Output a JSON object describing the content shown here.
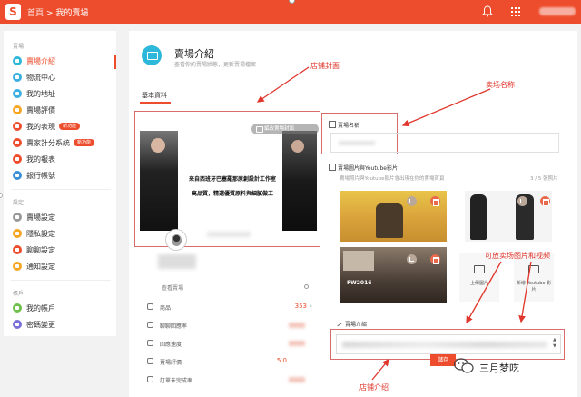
{
  "topbar": {
    "crumb_home": "首頁",
    "crumb_sep": ">",
    "crumb_current": "我的賣場"
  },
  "sidebar": {
    "sections": [
      {
        "title": "賣場",
        "items": [
          {
            "label": "賣場介紹",
            "color": "#2db7d8",
            "active": true
          },
          {
            "label": "物流中心",
            "color": "#3ab0e2"
          },
          {
            "label": "我的地址",
            "color": "#3ab0e2"
          },
          {
            "label": "賣場評價",
            "color": "#f5a623"
          },
          {
            "label": "我的表現",
            "color": "#ee4d2d",
            "badge": "新功能"
          },
          {
            "label": "賣家計分系統",
            "color": "#ee4d2d",
            "badge": "新功能"
          },
          {
            "label": "我的報表",
            "color": "#ee4d2d"
          },
          {
            "label": "銀行帳號",
            "color": "#3a8fd8"
          }
        ]
      },
      {
        "title": "設定",
        "items": [
          {
            "label": "賣場設定",
            "color": "#999999"
          },
          {
            "label": "隱私設定",
            "color": "#f5a623"
          },
          {
            "label": "聊聊設定",
            "color": "#ee4d2d"
          },
          {
            "label": "通知設定",
            "color": "#f5a623"
          }
        ]
      },
      {
        "title": "帳戶",
        "items": [
          {
            "label": "我的帳戶",
            "color": "#6fbf4a"
          },
          {
            "label": "密碼變更",
            "color": "#7a6fd8"
          }
        ]
      }
    ]
  },
  "main": {
    "title": "賣場介紹",
    "subtitle": "查看你的賣場狀態，更新賣場檔案",
    "tab": "基本資料",
    "cover": {
      "edit_label": "編改賣場封面",
      "line1": "来自西班牙巴塞羅那原創設計工作室",
      "line2": "高品質，精選優質原料與細膩做工"
    },
    "view_shop": "查看賣場",
    "stats": [
      {
        "label": "商品",
        "value": "353"
      },
      {
        "label": "聊聊回應率",
        "value": ""
      },
      {
        "label": "回應速度",
        "value": ""
      },
      {
        "label": "賣場評價",
        "value": "5.0"
      },
      {
        "label": "訂單未完成率",
        "value": ""
      }
    ],
    "name_field": {
      "label": "賣場名稱"
    },
    "media": {
      "label": "賣場圖片與Youtube影片",
      "sub": "賣場照片與Youtube影片會出現在你的賣場首頁",
      "count": "3 / 5 張照片",
      "upload_image": "上傳圖片",
      "add_youtube_1": "新增 Youtube 影",
      "add_youtube_2": "片",
      "fw_label": "FW2016"
    },
    "description": {
      "label": "賣場介紹",
      "save": "儲存"
    }
  },
  "annotations": {
    "cover": "店铺封面",
    "name": "卖场名称",
    "media": "可放卖场图片和视频",
    "intro": "店铺介绍"
  },
  "watermark": "三月梦呓"
}
